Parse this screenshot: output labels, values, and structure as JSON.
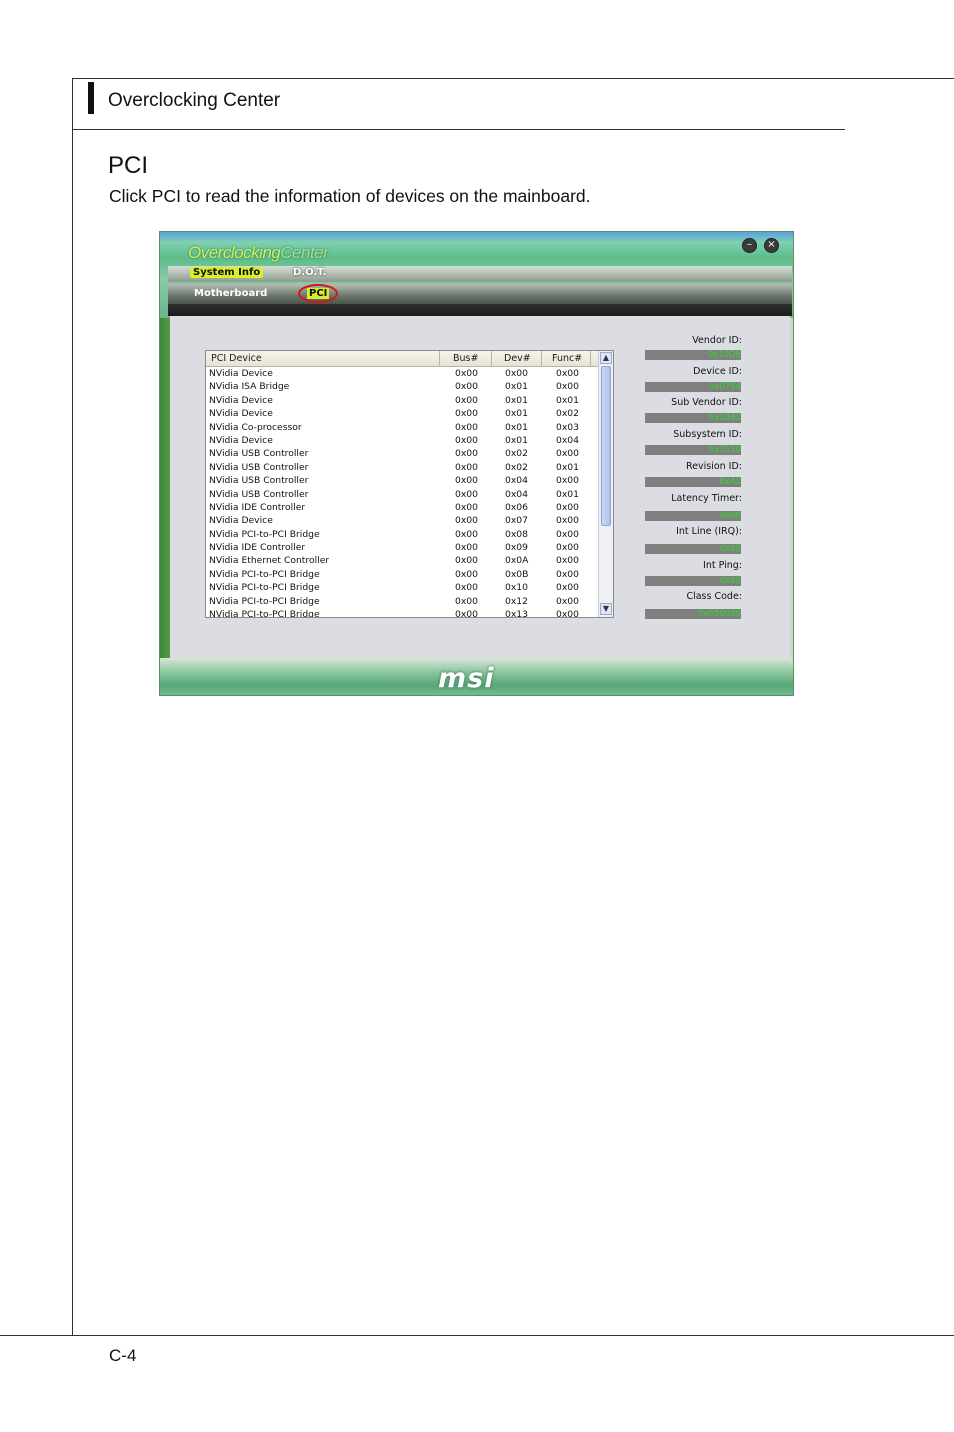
{
  "header": {
    "title": "Overclocking Center"
  },
  "section": {
    "title": "PCI",
    "description": "Click PCI to read the information of devices on the mainboard."
  },
  "footer": {
    "page_number": "C-4"
  },
  "app": {
    "logo_part1": "Overclocking",
    "logo_part2": "Center",
    "nav": {
      "system_info": "System Info",
      "dot": "D.O.T.",
      "motherboard": "Motherboard",
      "pci": "PCI"
    },
    "list": {
      "headers": {
        "device": "PCI Device",
        "bus": "Bus#",
        "dev": "Dev#",
        "func": "Func#"
      },
      "rows": [
        {
          "device": "NVidia Device",
          "bus": "0x00",
          "dev": "0x00",
          "func": "0x00"
        },
        {
          "device": "NVidia ISA Bridge",
          "bus": "0x00",
          "dev": "0x01",
          "func": "0x00"
        },
        {
          "device": "NVidia Device",
          "bus": "0x00",
          "dev": "0x01",
          "func": "0x01"
        },
        {
          "device": "NVidia Device",
          "bus": "0x00",
          "dev": "0x01",
          "func": "0x02"
        },
        {
          "device": "NVidia Co-processor",
          "bus": "0x00",
          "dev": "0x01",
          "func": "0x03"
        },
        {
          "device": "NVidia Device",
          "bus": "0x00",
          "dev": "0x01",
          "func": "0x04"
        },
        {
          "device": "NVidia USB Controller",
          "bus": "0x00",
          "dev": "0x02",
          "func": "0x00"
        },
        {
          "device": "NVidia USB Controller",
          "bus": "0x00",
          "dev": "0x02",
          "func": "0x01"
        },
        {
          "device": "NVidia USB Controller",
          "bus": "0x00",
          "dev": "0x04",
          "func": "0x00"
        },
        {
          "device": "NVidia USB Controller",
          "bus": "0x00",
          "dev": "0x04",
          "func": "0x01"
        },
        {
          "device": "NVidia IDE Controller",
          "bus": "0x00",
          "dev": "0x06",
          "func": "0x00"
        },
        {
          "device": "NVidia Device",
          "bus": "0x00",
          "dev": "0x07",
          "func": "0x00"
        },
        {
          "device": "NVidia PCI-to-PCI Bridge",
          "bus": "0x00",
          "dev": "0x08",
          "func": "0x00"
        },
        {
          "device": "NVidia IDE Controller",
          "bus": "0x00",
          "dev": "0x09",
          "func": "0x00"
        },
        {
          "device": "NVidia Ethernet Controller",
          "bus": "0x00",
          "dev": "0x0A",
          "func": "0x00"
        },
        {
          "device": "NVidia PCI-to-PCI Bridge",
          "bus": "0x00",
          "dev": "0x0B",
          "func": "0x00"
        },
        {
          "device": "NVidia PCI-to-PCI Bridge",
          "bus": "0x00",
          "dev": "0x10",
          "func": "0x00"
        },
        {
          "device": "NVidia PCI-to-PCI Bridge",
          "bus": "0x00",
          "dev": "0x12",
          "func": "0x00"
        },
        {
          "device": "NVidia PCI-to-PCI Bridge",
          "bus": "0x00",
          "dev": "0x13",
          "func": "0x00"
        }
      ]
    },
    "info": {
      "vendor_id_label": "Vendor ID:",
      "vendor_id_value": "0x10DE",
      "device_id_label": "Device ID:",
      "device_id_value": "0x0754",
      "sub_vendor_id_label": "Sub Vendor ID:",
      "sub_vendor_id_value": "0x1462",
      "subsystem_id_label": "Subsystem ID:",
      "subsystem_id_value": "0x7510",
      "revision_id_label": "Revision ID:",
      "revision_id_value": "0xA2",
      "latency_timer_label": "Latency Timer:",
      "latency_timer_value": "0x00",
      "int_line_label": "Int Line (IRQ):",
      "int_line_value": "0x00",
      "int_ping_label": "Int Ping:",
      "int_ping_value": "0x00",
      "class_code_label": "Class Code:",
      "class_code_value": "0x050000"
    },
    "brand": "msi",
    "colors": {
      "value_text": "#28e028",
      "pci_highlight": "#d01818",
      "tab_yellow": "#d9ef2a"
    }
  }
}
